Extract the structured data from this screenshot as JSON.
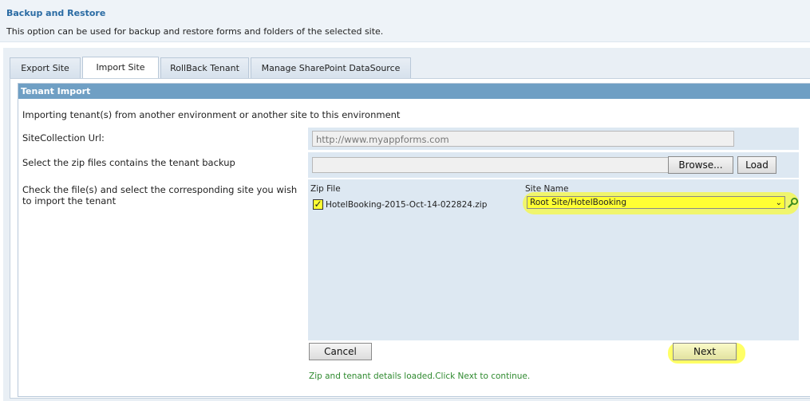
{
  "header": {
    "title": "Backup and Restore",
    "description": "This option can be used for backup and restore forms and folders of the selected site."
  },
  "tabs": [
    {
      "label": "Export Site"
    },
    {
      "label": "Import Site",
      "active": true
    },
    {
      "label": "RollBack Tenant"
    },
    {
      "label": "Manage SharePoint DataSource"
    }
  ],
  "section": {
    "title": "Tenant Import",
    "intro": "Importing tenant(s) from another environment or another site to this environment"
  },
  "form": {
    "site_url_label": "SiteCollection Url:",
    "site_url_value": "http://www.myappforms.com",
    "zip_label": "Select the zip files contains the tenant backup",
    "browse_label": "Browse...",
    "load_label": "Load",
    "check_label": "Check the file(s) and select the corresponding site you wish to import the tenant",
    "col_zip": "Zip File",
    "col_site": "Site Name",
    "rows": [
      {
        "checked": true,
        "zip": "HotelBooking-2015-Oct-14-022824.zip",
        "site": "Root Site/HotelBooking"
      }
    ]
  },
  "actions": {
    "cancel_label": "Cancel",
    "next_label": "Next"
  },
  "status_message": "Zip and tenant details loaded.Click Next to continue.",
  "colors": {
    "header_title": "#2a6ba3",
    "section_head": "#6f9fc4",
    "highlight": "#ffff00",
    "status_text": "#2f8a2f"
  }
}
